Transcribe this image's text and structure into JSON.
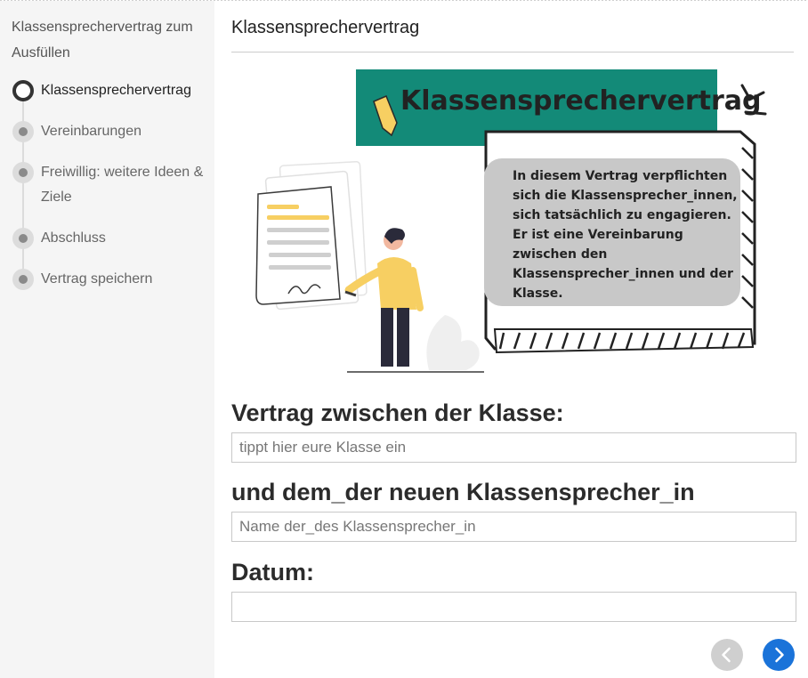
{
  "sidebar": {
    "title": "Klassensprechervertrag zum Ausfüllen",
    "steps": [
      {
        "label": "Klassensprechervertrag",
        "active": true
      },
      {
        "label": "Vereinbarungen",
        "active": false
      },
      {
        "label": "Freiwillig: weitere Ideen & Ziele",
        "active": false
      },
      {
        "label": "Abschluss",
        "active": false
      },
      {
        "label": "Vertrag speichern",
        "active": false
      }
    ]
  },
  "main": {
    "title": "Klassensprechervertrag",
    "illustration": {
      "banner_title": "Klassensprechervertrag",
      "description_lines": [
        "In diesem Vertrag verpflichten",
        "sich die Klassensprecher_innen,",
        "sich tatsächlich zu engagieren.",
        "Er ist eine Vereinbarung",
        "zwischen den",
        "Klassensprecher_innen und der",
        "Klasse."
      ],
      "colors": {
        "banner": "#138a78",
        "note_fill": "#c8c8c8",
        "accent_yellow": "#f7cf62"
      }
    },
    "fields": [
      {
        "heading": "Vertrag zwischen der Klasse:",
        "placeholder": "tippt hier eure Klasse ein",
        "value": ""
      },
      {
        "heading": "und dem_der neuen Klassensprecher_in",
        "placeholder": "Name der_des Klassensprecher_in",
        "value": ""
      },
      {
        "heading": "Datum:",
        "placeholder": "",
        "value": ""
      }
    ]
  },
  "navigation": {
    "prev_icon": "chevron-left-icon",
    "next_icon": "chevron-right-icon",
    "prev_color": "#cfcfcf",
    "next_color": "#1a73d9"
  }
}
